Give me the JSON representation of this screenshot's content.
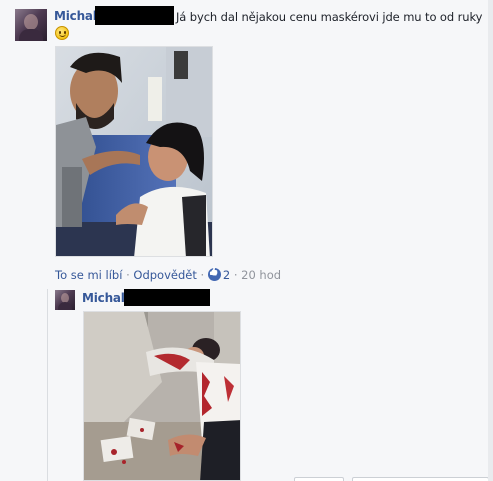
{
  "comment": {
    "author": "Michal",
    "text": "Já bych dal nějakou cenu maskérovi jde mu to od ruky",
    "emoji": "smile-emoji",
    "actions": {
      "like": "To se mi líbí",
      "separator": "·",
      "reply": "Odpovědět",
      "likes_count": "2",
      "time": "20 hod"
    }
  },
  "reply": {
    "author": "Michal"
  },
  "colors": {
    "link": "#365899",
    "background": "#f6f7f9",
    "redaction": "#000000",
    "like_badge": "#4267b2"
  }
}
